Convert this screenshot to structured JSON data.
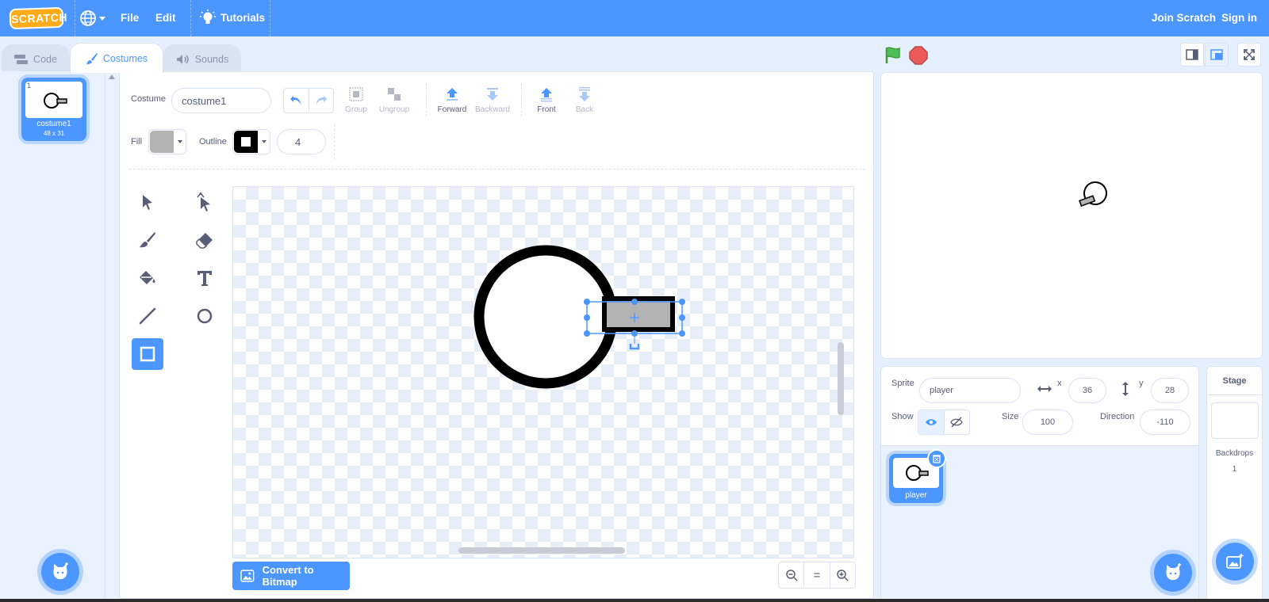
{
  "menubar": {
    "logo_text": "SCRATCH",
    "file_label": "File",
    "edit_label": "Edit",
    "tutorials_label": "Tutorials",
    "join_label": "Join Scratch",
    "signin_label": "Sign in"
  },
  "tabs": {
    "code": "Code",
    "costumes": "Costumes",
    "sounds": "Sounds"
  },
  "costume_list": {
    "items": [
      {
        "number": "1",
        "name": "costume1",
        "dims": "48 x 31"
      }
    ]
  },
  "paint": {
    "costume_label": "Costume",
    "costume_name": "costume1",
    "group_label": "Group",
    "ungroup_label": "Ungroup",
    "forward_label": "Forward",
    "backward_label": "Backward",
    "front_label": "Front",
    "back_label": "Back",
    "fill_label": "Fill",
    "outline_label": "Outline",
    "outline_width": "4",
    "fill_color": "#b3b3b3",
    "outline_color": "#000000",
    "convert_label": "Convert to Bitmap",
    "zoom_reset_label": "="
  },
  "sprite_info": {
    "sprite_label": "Sprite",
    "sprite_name": "player",
    "x_label": "x",
    "x_value": "36",
    "y_label": "y",
    "y_value": "28",
    "show_label": "Show",
    "size_label": "Size",
    "size_value": "100",
    "direction_label": "Direction",
    "direction_value": "-110"
  },
  "sprites": [
    {
      "name": "player"
    }
  ],
  "stage_pane": {
    "title": "Stage",
    "backdrops_label": "Backdrops",
    "backdrops_count": "1"
  },
  "colors": {
    "accent": "#4c97ff",
    "menubar": "#4c97ff",
    "active_tab_text": "#4c97ff",
    "flag_green": "#4cbf56",
    "stop_red": "#ec5959"
  }
}
